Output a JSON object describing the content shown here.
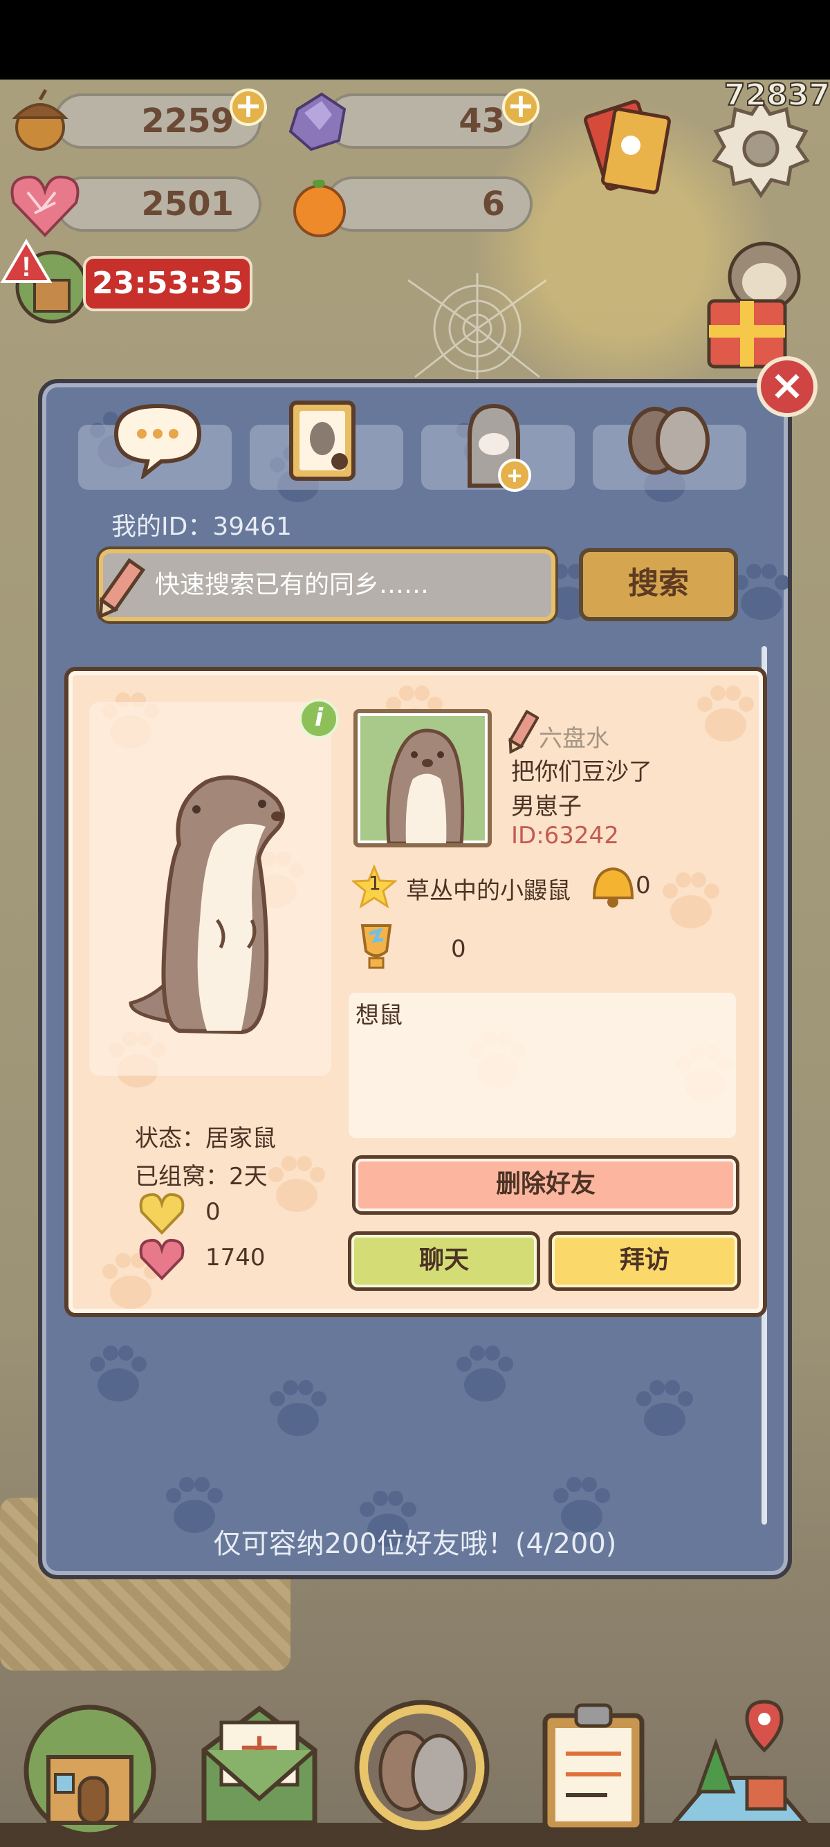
{
  "top_bar": {
    "acorn_count": "2259",
    "crystal_count": "43",
    "heart_count": "2501",
    "orange_count": "6",
    "timer": "23:53:35",
    "counter": "72837"
  },
  "friends_panel": {
    "my_id_label": "我的ID：39461",
    "search": {
      "placeholder": "快速搜索已有的同乡……",
      "button_label": "搜索"
    },
    "tabs": [
      {
        "icon": "chat-bubble-icon"
      },
      {
        "icon": "contact-book-icon"
      },
      {
        "icon": "add-friend-icon"
      },
      {
        "icon": "friends-icon"
      }
    ],
    "friend": {
      "hometown": "六盘水",
      "name": "把你们豆沙了",
      "gender_role": "男崽子",
      "id": "ID:63242",
      "level": "1",
      "title": "草丛中的小鼹鼠",
      "bell_count": "0",
      "trophy_count": "0",
      "signature": "想鼠",
      "status": "状态：居家鼠",
      "days_together": "已组窝：2天",
      "gold_heart_count": "0",
      "pink_heart_count": "1740",
      "delete_label": "删除好友",
      "chat_label": "聊天",
      "visit_label": "拜访"
    },
    "capacity_text": "仅可容纳200位好友哦！(4/200)"
  },
  "bottom_nav": [
    {
      "icon": "house-icon"
    },
    {
      "icon": "mail-envelope-icon"
    },
    {
      "icon": "friends-icon"
    },
    {
      "icon": "task-clipboard-icon"
    },
    {
      "icon": "map-icon"
    }
  ]
}
